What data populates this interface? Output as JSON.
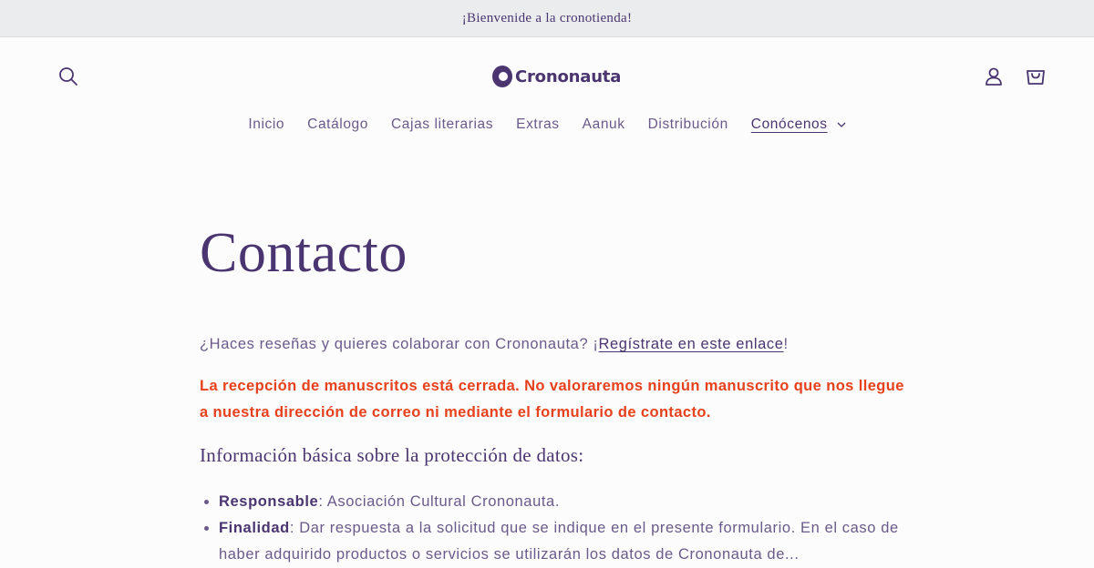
{
  "announcement": {
    "text": "¡Bienvenide a la cronotienda!"
  },
  "header": {
    "logo_text": "Crononauta",
    "icons": {
      "search": "search-icon",
      "account": "account-icon",
      "cart": "cart-icon"
    }
  },
  "nav": {
    "items": [
      {
        "label": "Inicio"
      },
      {
        "label": "Catálogo"
      },
      {
        "label": "Cajas literarias"
      },
      {
        "label": "Extras"
      },
      {
        "label": "Aanuk"
      },
      {
        "label": "Distribución"
      },
      {
        "label": "Conócenos",
        "active": true,
        "has_dropdown": true
      }
    ]
  },
  "main": {
    "title": "Contacto",
    "intro_prefix": "¿Haces reseñas y quieres colaborar con Crononauta? ¡",
    "intro_link": "Regístrate en este enlace",
    "intro_suffix": "!",
    "warning": "La recepción de manuscritos está cerrada. No valoraremos ningún manuscrito que nos llegue a nuestra dirección de correo ni mediante el formulario de contacto.",
    "data_heading": "Información básica sobre la protección de datos:",
    "data_items": [
      {
        "term": "Responsable",
        "text": ": Asociación Cultural Crononauta."
      },
      {
        "term": "Finalidad",
        "text": ": Dar respuesta a la solicitud que se indique en el presente formulario. En el caso de haber adquirido productos o servicios se utilizarán los datos de Crononauta de..."
      }
    ]
  },
  "colors": {
    "brand": "#4a3570",
    "warning": "#e8401c",
    "announcement_bg": "#ebecee"
  }
}
